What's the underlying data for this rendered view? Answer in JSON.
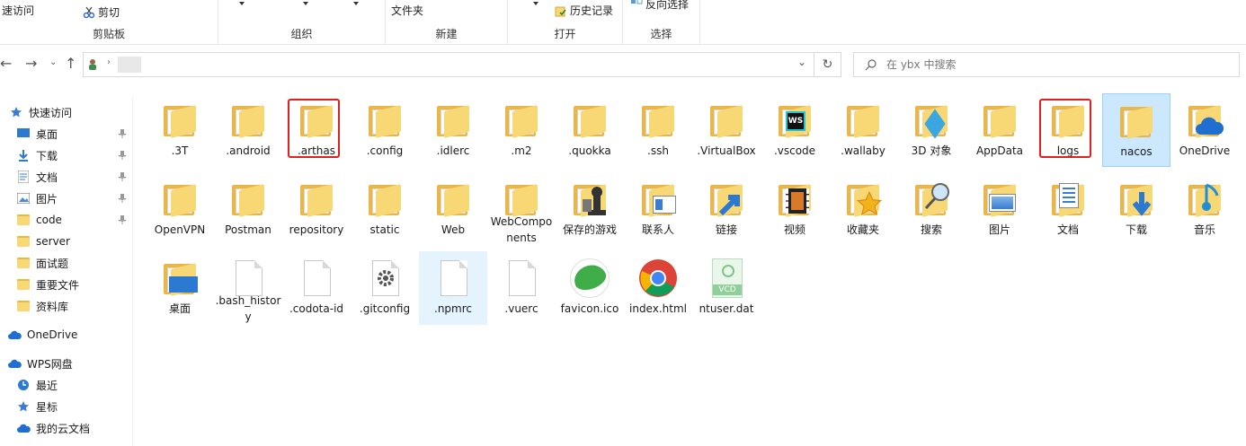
{
  "ribbon": {
    "quick_access": "速访问",
    "cut": "剪切",
    "folder": "文件夹",
    "history": "历史记录",
    "reverse_select": "反向选择",
    "groups": [
      "剪贴板",
      "组织",
      "新建",
      "打开",
      "选择"
    ]
  },
  "search": {
    "placeholder": "在 ybx 中搜索"
  },
  "sidebar": {
    "items": [
      {
        "label": "快速访问",
        "icon": "star-icon"
      },
      {
        "label": "桌面",
        "icon": "desktop-icon",
        "pinned": true
      },
      {
        "label": "下载",
        "icon": "download-icon",
        "pinned": true
      },
      {
        "label": "文档",
        "icon": "document-icon",
        "pinned": true
      },
      {
        "label": "图片",
        "icon": "picture-icon",
        "pinned": true
      },
      {
        "label": "code",
        "icon": "folder-icon",
        "pinned": true
      },
      {
        "label": "server",
        "icon": "folder-icon"
      },
      {
        "label": "面试题",
        "icon": "folder-icon"
      },
      {
        "label": "重要文件",
        "icon": "folder-icon"
      },
      {
        "label": "资料库",
        "icon": "folder-icon"
      },
      {
        "label": "OneDrive",
        "icon": "cloud-icon"
      },
      {
        "label": "WPS网盘",
        "icon": "cloud-icon"
      },
      {
        "label": "最近",
        "icon": "clock-icon"
      },
      {
        "label": "星标",
        "icon": "star-icon"
      },
      {
        "label": "我的云文档",
        "icon": "cloud-icon"
      }
    ]
  },
  "files": [
    {
      "label": ".3T",
      "kind": "folder"
    },
    {
      "label": ".android",
      "kind": "folder"
    },
    {
      "label": ".arthas",
      "kind": "folder"
    },
    {
      "label": ".config",
      "kind": "folder"
    },
    {
      "label": ".idlerc",
      "kind": "folder"
    },
    {
      "label": ".m2",
      "kind": "folder"
    },
    {
      "label": ".quokka",
      "kind": "folder"
    },
    {
      "label": ".ssh",
      "kind": "folder"
    },
    {
      "label": ".VirtualBox",
      "kind": "folder"
    },
    {
      "label": ".vscode",
      "kind": "folder-ws"
    },
    {
      "label": ".wallaby",
      "kind": "folder"
    },
    {
      "label": "3D 对象",
      "kind": "folder-3d"
    },
    {
      "label": "AppData",
      "kind": "folder"
    },
    {
      "label": "logs",
      "kind": "folder"
    },
    {
      "label": "nacos",
      "kind": "folder"
    },
    {
      "label": "OneDrive",
      "kind": "folder-cloud"
    },
    {
      "label": "OpenVPN",
      "kind": "folder"
    },
    {
      "label": "Postman",
      "kind": "folder"
    },
    {
      "label": "repository",
      "kind": "folder"
    },
    {
      "label": "static",
      "kind": "folder"
    },
    {
      "label": "Web",
      "kind": "folder"
    },
    {
      "label": "WebComponents",
      "kind": "folder"
    },
    {
      "label": "保存的游戏",
      "kind": "folder-game"
    },
    {
      "label": "联系人",
      "kind": "folder-contact"
    },
    {
      "label": "链接",
      "kind": "folder-link"
    },
    {
      "label": "视频",
      "kind": "folder-video"
    },
    {
      "label": "收藏夹",
      "kind": "folder-star"
    },
    {
      "label": "搜索",
      "kind": "folder-search"
    },
    {
      "label": "图片",
      "kind": "folder-picture"
    },
    {
      "label": "文档",
      "kind": "folder-doc"
    },
    {
      "label": "下载",
      "kind": "folder-download"
    },
    {
      "label": "音乐",
      "kind": "folder-music"
    },
    {
      "label": "桌面",
      "kind": "folder-desktop"
    },
    {
      "label": ".bash_history",
      "kind": "file"
    },
    {
      "label": ".codota-id",
      "kind": "file"
    },
    {
      "label": ".gitconfig",
      "kind": "file-gear"
    },
    {
      "label": ".npmrc",
      "kind": "file"
    },
    {
      "label": ".vuerc",
      "kind": "file"
    },
    {
      "label": "favicon.ico",
      "kind": "ico"
    },
    {
      "label": "index.html",
      "kind": "chrome"
    },
    {
      "label": "ntuser.dat",
      "kind": "vcd"
    }
  ],
  "colors": {
    "highlight": "#e0201f",
    "selection": "#cce8ff",
    "folder": "#f8d775"
  }
}
